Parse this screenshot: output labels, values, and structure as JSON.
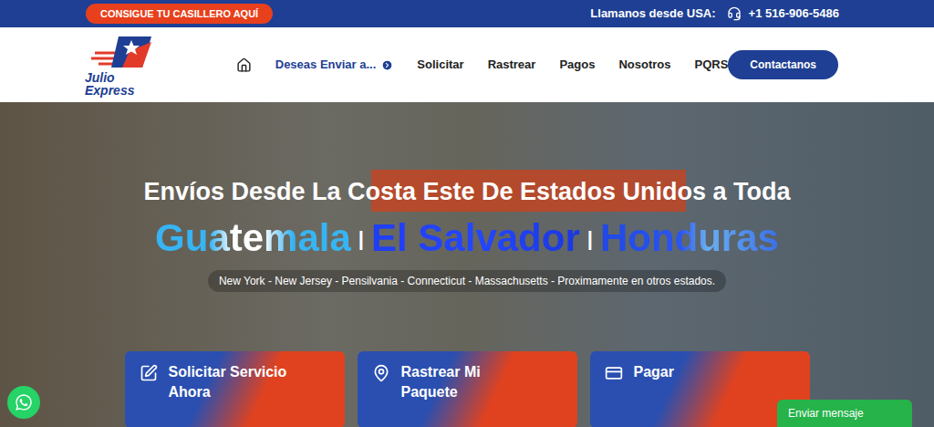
{
  "top_bar": {
    "locker_button": "CONSIGUE TU CASILLERO AQUÍ",
    "phone_label": "Llamanos desde USA:",
    "phone": "+1 516-906-5486"
  },
  "logo": {
    "text": "Julio Express"
  },
  "nav": {
    "items": [
      {
        "label": "Deseas Enviar a...",
        "selected": true,
        "kind": "dropdown"
      },
      {
        "label": "Solicitar",
        "selected": false,
        "kind": "link"
      },
      {
        "label": "Rastrear",
        "selected": false,
        "kind": "link"
      },
      {
        "label": "Pagos",
        "selected": false,
        "kind": "link"
      },
      {
        "label": "Nosotros",
        "selected": false,
        "kind": "link"
      },
      {
        "label": "PQRS",
        "selected": false,
        "kind": "link"
      }
    ],
    "contact_button": "Contactanos"
  },
  "hero": {
    "headline": "Envíos Desde La Costa Este De Estados Unidos a Toda",
    "countries": [
      "Guatemala",
      "El Salvador",
      "Honduras"
    ],
    "separator": "|",
    "states": "New York - New Jersey - Pensilvania - Connecticut - Massachusetts - Proximamente en otros estados."
  },
  "actions": [
    {
      "label": "Solicitar Servicio Ahora",
      "kind": "request"
    },
    {
      "label": "Rastrear Mi Paquete",
      "kind": "track"
    },
    {
      "label": "Pagar",
      "kind": "pay"
    }
  ],
  "chat": {
    "label": "Enviar mensaje"
  }
}
